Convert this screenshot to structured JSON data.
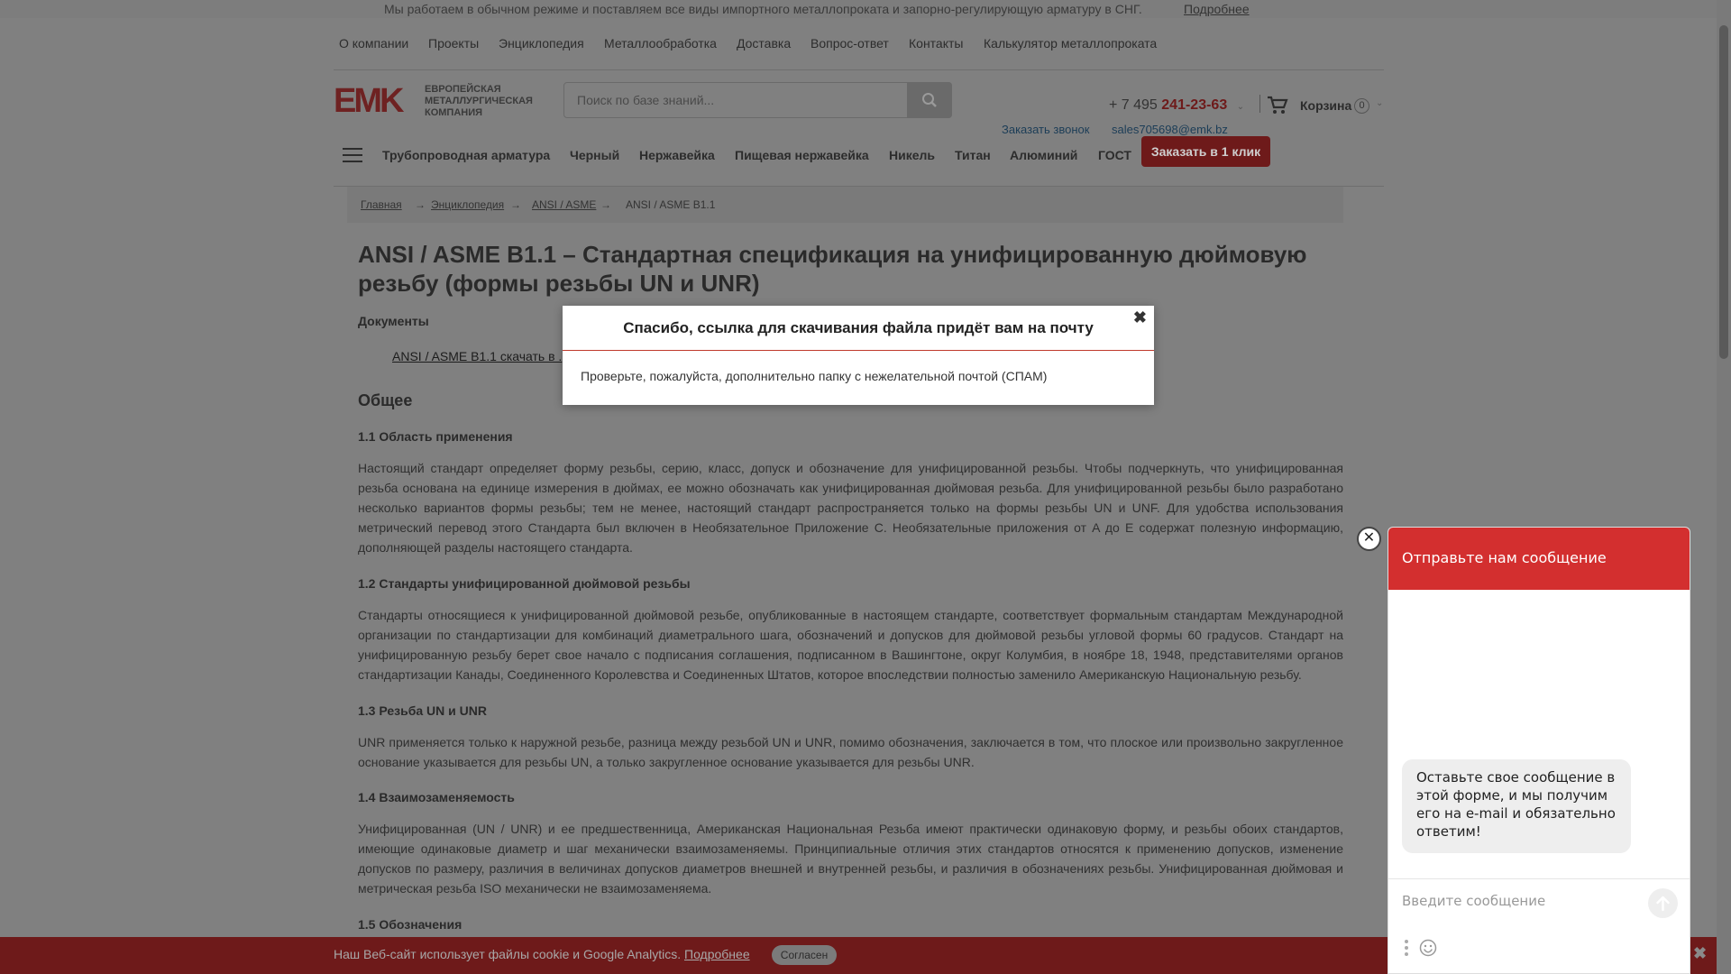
{
  "topbar": {
    "message": "Мы работаем в обычном режиме и поставляем все виды импортного металлопроката и запорно-регулирующую арматуру в СНГ.",
    "more": "Подробнее"
  },
  "topnav": [
    "О компании",
    "Проекты",
    "Энциклопедия",
    "Металлообработка",
    "Доставка",
    "Вопрос-ответ",
    "Контакты",
    "Калькулятор металлопроката"
  ],
  "logo": {
    "mark": "EMK",
    "text": "ЕВРОПЕЙСКАЯ МЕТАЛЛУРГИЧЕСКАЯ КОМПАНИЯ"
  },
  "search": {
    "placeholder": "Поиск по базе знаний..."
  },
  "contact": {
    "phone_prefix": "+ 7 495",
    "phone_number": "241-23-63",
    "callback": "Заказать звонок",
    "email": "sales705698@emk.bz"
  },
  "cart": {
    "label": "Корзина",
    "count": "0"
  },
  "mainnav": {
    "items": [
      "Трубопроводная арматура",
      "Черный",
      "Нержавейка",
      "Пищевая нержавейка",
      "Никель",
      "Титан",
      "Алюминий",
      "ГОСТ"
    ],
    "order_button": "Заказать в 1 клик"
  },
  "breadcrumb": [
    "Главная",
    "Энциклопедия",
    "ANSI / ASME",
    "ANSI / ASME B1.1"
  ],
  "article": {
    "title": "ANSI / ASME B1.1 – Стандартная спецификация на унифицированную дюймовую резьбу (формы резьбы UN и UNR)",
    "docs_label": "Документы",
    "doc_link": "ANSI / ASME B1.1 скачать в .",
    "section": "Общее",
    "s1_title": "1.1 Область применения",
    "s1_text": "Настоящий стандарт определяет форму резьбы, серию, класс, допуск и обозначение для унифицированной резьбы. Чтобы подчеркнуть, что унифицированная резьба основана на единице измерения в дюймах, ее можно обозначать как унифицированная дюймовая резьба. Для унифицированной резьбы было разработано несколько вариантов формы резьбы; тем не менее, настоящий стандарт распространяется только на формы резьбы UN и UNF. Для удобства использования метрический перевод этого Стандарта был включен в Необязательное Приложение C. Необязательные приложения от A до E содержат полезную информацию, дополняющей разделы настоящего стандарта.",
    "s2_title": "1.2 Стандарты унифицированной дюймовой резьбы",
    "s2_text": "Стандарты относящиеся к унифицированной дюймовой резьбе, опубликованные в настоящем стандарте, соответствует формальным стандартам Международной организации по стандартизации для комбинаций диаметрального шага, обозначений и допусков для дюймовой резьбы угловой формы 60 градусов. Стандарт на унифицированную резьбу берет свое начало с подписания соглашения, подписанном в Вашингтоне, округ Колумбия, в ноябре 18, 1948, представителями органов стандартизации Канады, Соединенного Королевства и Соединенных Штатов, которое впоследствии полностью заменило Американскую Национальную резьбу.",
    "s3_title": "1.3 Резьба UN и UNR",
    "s3_text": "UNR применяется только к наружной резьбе, разница между резьбой UN и UNR, помимо обозначения, заключается в том, что плоское или произвольно закругленное основание указывается для резьбы UN, а только закругленное основание указывается для резьбы UNR.",
    "s4_title": "1.4 Взаимозаменяемость",
    "s4_text": "Унифицированная (UN / UNR) и ее предшественница, Американская Национальная Резьба имеют практически одинаковую форму, и резьбы обоих стандартов, имеющие одинаковые диаметр и шаг механически взаимозаменяемы. Принципиальные отличия этих стандартов относятся к применению допусков, изменение допусков по размеру, различия в величинах допусков диаметров внешней и внутренней резьбы, и различия в обозначениях резьбы. Унифицированная дюймовая и метрическая резьба ISO механически не взаимозаменяема.",
    "s5_title": "1.5 Обозначения"
  },
  "modal": {
    "title": "Спасибо, ссылка для скачивания файла придёт вам на почту",
    "close": "✖",
    "text": "Проверьте, пожалуйста, дополнительно папку с нежелательной почтой (СПАМ)"
  },
  "cookie": {
    "text": "Наш Веб-сайт использует файлы cookie и Google Analytics.",
    "more": "Подробнее",
    "accept": "Согласен",
    "close": "✖"
  },
  "chat": {
    "close": "✕",
    "title": "Отправьте нам сообщение",
    "bubble": "Оставьте свое сообщение в этой форме, и мы получим его на e-mail и обязательно ответим!",
    "placeholder": "Введите сообщение"
  },
  "colors": {
    "brand_red": "#d32f2f",
    "overlay_gray": "#808080"
  }
}
